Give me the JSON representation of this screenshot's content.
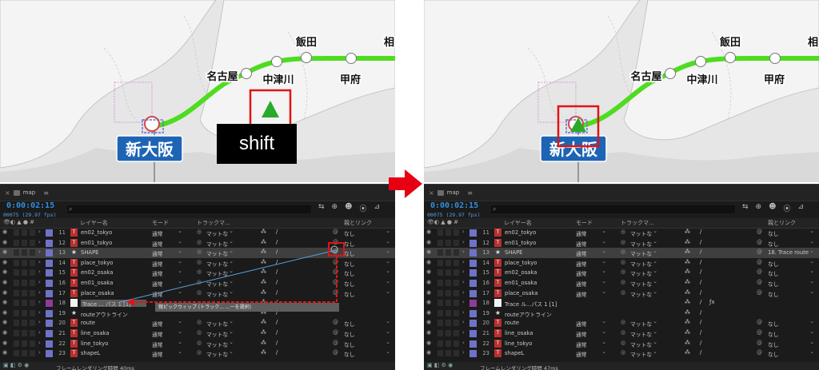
{
  "colors": {
    "route_green": "#4fdc20",
    "highlight_red": "#e01414",
    "arrow_red": "#e60012",
    "station_sign_blue": "#1e64b4",
    "timecode_blue": "#2f8fe0",
    "ae_bg": "#1b1b1b"
  },
  "map": {
    "stations": {
      "shin_osaka": "新大阪",
      "nagoya": "名古屋",
      "nakatsugawa": "中津川",
      "iida": "飯田",
      "kofu": "甲府",
      "sagamihara": "相"
    }
  },
  "ae": {
    "tab_name": "map",
    "timecode": "0:00:02:15",
    "fps": "00075 (29.97 fps)",
    "search_placeholder": "",
    "headers": {
      "layer_name": "レイヤー名",
      "mode": "モード",
      "track_matte": "トラックマ...",
      "parent": "親とリンク"
    }
  },
  "panels": {
    "left": {
      "tooltip": "親ピックウィップ (トラック... ...ーを選択)",
      "shift_label": "shift",
      "status": "フレームレンダリング時間 40ms",
      "rows": [
        {
          "num": "11",
          "type": "text",
          "name": "en02_tokyo",
          "mode": "通常",
          "matte": "マットな",
          "parent": "なし",
          "selected": false,
          "partial": true
        },
        {
          "num": "12",
          "type": "text",
          "name": "en01_tokyo",
          "mode": "通常",
          "matte": "マットな",
          "parent": "なし",
          "selected": false
        },
        {
          "num": "13",
          "type": "shape",
          "name": "SHAPE",
          "mode": "通常",
          "matte": "マットな",
          "parent": "なし",
          "selected": true
        },
        {
          "num": "14",
          "type": "text",
          "name": "place_tokyo",
          "mode": "通常",
          "matte": "マットな",
          "parent": "なし",
          "selected": false
        },
        {
          "num": "15",
          "type": "text",
          "name": "en02_osaka",
          "mode": "通常",
          "matte": "マットな",
          "parent": "なし",
          "selected": false
        },
        {
          "num": "16",
          "type": "text",
          "name": "en01_osaka",
          "mode": "通常",
          "matte": "マットな",
          "parent": "なし",
          "selected": false
        },
        {
          "num": "17",
          "type": "text",
          "name": "place_osaka",
          "mode": "通常",
          "matte": "マットな",
          "parent": "なし",
          "selected": false
        },
        {
          "num": "18",
          "type": "white",
          "name": "Trace ... パス 1 [1]",
          "mode": "",
          "matte": "",
          "parent": "",
          "selected": false,
          "editing": true
        },
        {
          "num": "19",
          "type": "shape",
          "name": "routeアウトライン",
          "mode": "",
          "matte": "",
          "parent": "",
          "selected": false
        },
        {
          "num": "20",
          "type": "text",
          "name": "route",
          "mode": "通常",
          "matte": "マットな",
          "parent": "なし",
          "selected": false
        },
        {
          "num": "21",
          "type": "text",
          "name": "line_osaka",
          "mode": "通常",
          "matte": "マットな",
          "parent": "なし",
          "selected": false
        },
        {
          "num": "22",
          "type": "text",
          "name": "line_tokyo",
          "mode": "通常",
          "matte": "マットな",
          "parent": "なし",
          "selected": false
        },
        {
          "num": "23",
          "type": "text",
          "name": "shapeL",
          "mode": "通常",
          "matte": "マットな",
          "parent": "なし",
          "selected": false
        }
      ]
    },
    "right": {
      "status": "フレームレンダリング時間 47ms",
      "rows": [
        {
          "num": "11",
          "type": "text",
          "name": "en02_tokyo",
          "mode": "通常",
          "matte": "マットな",
          "parent": "なし",
          "selected": false,
          "partial": true
        },
        {
          "num": "12",
          "type": "text",
          "name": "en01_tokyo",
          "mode": "通常",
          "matte": "マットな",
          "parent": "なし",
          "selected": false
        },
        {
          "num": "13",
          "type": "shape",
          "name": "SHAPE",
          "mode": "通常",
          "matte": "マットな",
          "parent": "18. Trace route",
          "selected": true
        },
        {
          "num": "14",
          "type": "text",
          "name": "place_tokyo",
          "mode": "通常",
          "matte": "マットな",
          "parent": "なし",
          "selected": false
        },
        {
          "num": "15",
          "type": "text",
          "name": "en02_osaka",
          "mode": "通常",
          "matte": "マットな",
          "parent": "なし",
          "selected": false
        },
        {
          "num": "16",
          "type": "text",
          "name": "en01_osaka",
          "mode": "通常",
          "matte": "マットな",
          "parent": "なし",
          "selected": false
        },
        {
          "num": "17",
          "type": "text",
          "name": "place_osaka",
          "mode": "通常",
          "matte": "マットな",
          "parent": "なし",
          "selected": false
        },
        {
          "num": "18",
          "type": "white",
          "name": "Trace ル...パス 1 [1]",
          "mode": "",
          "matte": "",
          "parent": "",
          "selected": false,
          "fx": true
        },
        {
          "num": "19",
          "type": "shape",
          "name": "routeアウトライン",
          "mode": "",
          "matte": "",
          "parent": "",
          "selected": false
        },
        {
          "num": "20",
          "type": "text",
          "name": "route",
          "mode": "通常",
          "matte": "マットな",
          "parent": "なし",
          "selected": false
        },
        {
          "num": "21",
          "type": "text",
          "name": "line_osaka",
          "mode": "通常",
          "matte": "マットな",
          "parent": "なし",
          "selected": false
        },
        {
          "num": "22",
          "type": "text",
          "name": "line_tokyo",
          "mode": "通常",
          "matte": "マットな",
          "parent": "なし",
          "selected": false
        },
        {
          "num": "23",
          "type": "text",
          "name": "shapeL",
          "mode": "通常",
          "matte": "マットな",
          "parent": "なし",
          "selected": false
        }
      ]
    }
  }
}
